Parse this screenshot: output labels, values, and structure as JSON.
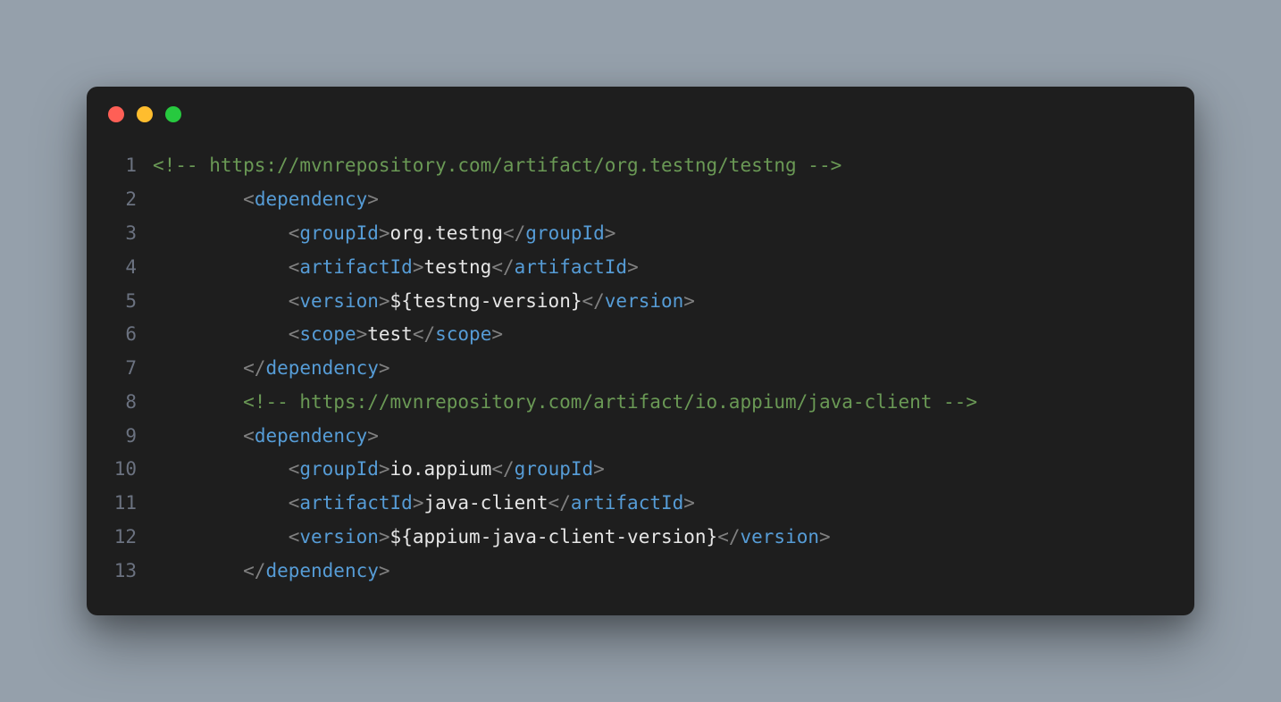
{
  "titlebar": {
    "dots": [
      "red",
      "yellow",
      "green"
    ]
  },
  "code": {
    "lines": [
      {
        "num": "1",
        "indent": "",
        "tokens": [
          {
            "cls": "tok-comment",
            "text": "<!-- https://mvnrepository.com/artifact/org.testng/testng -->"
          }
        ]
      },
      {
        "num": "2",
        "indent": "        ",
        "tokens": [
          {
            "cls": "tok-punct",
            "text": "<"
          },
          {
            "cls": "tok-tag",
            "text": "dependency"
          },
          {
            "cls": "tok-punct",
            "text": ">"
          }
        ]
      },
      {
        "num": "3",
        "indent": "            ",
        "tokens": [
          {
            "cls": "tok-punct",
            "text": "<"
          },
          {
            "cls": "tok-tag",
            "text": "groupId"
          },
          {
            "cls": "tok-punct",
            "text": ">"
          },
          {
            "cls": "tok-text",
            "text": "org.testng"
          },
          {
            "cls": "tok-punct",
            "text": "</"
          },
          {
            "cls": "tok-tag",
            "text": "groupId"
          },
          {
            "cls": "tok-punct",
            "text": ">"
          }
        ]
      },
      {
        "num": "4",
        "indent": "            ",
        "tokens": [
          {
            "cls": "tok-punct",
            "text": "<"
          },
          {
            "cls": "tok-tag",
            "text": "artifactId"
          },
          {
            "cls": "tok-punct",
            "text": ">"
          },
          {
            "cls": "tok-text",
            "text": "testng"
          },
          {
            "cls": "tok-punct",
            "text": "</"
          },
          {
            "cls": "tok-tag",
            "text": "artifactId"
          },
          {
            "cls": "tok-punct",
            "text": ">"
          }
        ]
      },
      {
        "num": "5",
        "indent": "            ",
        "tokens": [
          {
            "cls": "tok-punct",
            "text": "<"
          },
          {
            "cls": "tok-tag",
            "text": "version"
          },
          {
            "cls": "tok-punct",
            "text": ">"
          },
          {
            "cls": "tok-var",
            "text": "${testng-version}"
          },
          {
            "cls": "tok-punct",
            "text": "</"
          },
          {
            "cls": "tok-tag",
            "text": "version"
          },
          {
            "cls": "tok-punct",
            "text": ">"
          }
        ]
      },
      {
        "num": "6",
        "indent": "            ",
        "tokens": [
          {
            "cls": "tok-punct",
            "text": "<"
          },
          {
            "cls": "tok-tag",
            "text": "scope"
          },
          {
            "cls": "tok-punct",
            "text": ">"
          },
          {
            "cls": "tok-text",
            "text": "test"
          },
          {
            "cls": "tok-punct",
            "text": "</"
          },
          {
            "cls": "tok-tag",
            "text": "scope"
          },
          {
            "cls": "tok-punct",
            "text": ">"
          }
        ]
      },
      {
        "num": "7",
        "indent": "        ",
        "tokens": [
          {
            "cls": "tok-punct",
            "text": "</"
          },
          {
            "cls": "tok-tag",
            "text": "dependency"
          },
          {
            "cls": "tok-punct",
            "text": ">"
          }
        ]
      },
      {
        "num": "8",
        "indent": "        ",
        "tokens": [
          {
            "cls": "tok-comment",
            "text": "<!-- https://mvnrepository.com/artifact/io.appium/java-client -->"
          }
        ]
      },
      {
        "num": "9",
        "indent": "        ",
        "tokens": [
          {
            "cls": "tok-punct",
            "text": "<"
          },
          {
            "cls": "tok-tag",
            "text": "dependency"
          },
          {
            "cls": "tok-punct",
            "text": ">"
          }
        ]
      },
      {
        "num": "10",
        "indent": "            ",
        "tokens": [
          {
            "cls": "tok-punct",
            "text": "<"
          },
          {
            "cls": "tok-tag",
            "text": "groupId"
          },
          {
            "cls": "tok-punct",
            "text": ">"
          },
          {
            "cls": "tok-text",
            "text": "io.appium"
          },
          {
            "cls": "tok-punct",
            "text": "</"
          },
          {
            "cls": "tok-tag",
            "text": "groupId"
          },
          {
            "cls": "tok-punct",
            "text": ">"
          }
        ]
      },
      {
        "num": "11",
        "indent": "            ",
        "tokens": [
          {
            "cls": "tok-punct",
            "text": "<"
          },
          {
            "cls": "tok-tag",
            "text": "artifactId"
          },
          {
            "cls": "tok-punct",
            "text": ">"
          },
          {
            "cls": "tok-text",
            "text": "java-client"
          },
          {
            "cls": "tok-punct",
            "text": "</"
          },
          {
            "cls": "tok-tag",
            "text": "artifactId"
          },
          {
            "cls": "tok-punct",
            "text": ">"
          }
        ]
      },
      {
        "num": "12",
        "indent": "            ",
        "tokens": [
          {
            "cls": "tok-punct",
            "text": "<"
          },
          {
            "cls": "tok-tag",
            "text": "version"
          },
          {
            "cls": "tok-punct",
            "text": ">"
          },
          {
            "cls": "tok-var",
            "text": "${appium-java-client-version}"
          },
          {
            "cls": "tok-punct",
            "text": "</"
          },
          {
            "cls": "tok-tag",
            "text": "version"
          },
          {
            "cls": "tok-punct",
            "text": ">"
          }
        ]
      },
      {
        "num": "13",
        "indent": "        ",
        "tokens": [
          {
            "cls": "tok-punct",
            "text": "</"
          },
          {
            "cls": "tok-tag",
            "text": "dependency"
          },
          {
            "cls": "tok-punct",
            "text": ">"
          }
        ]
      }
    ]
  }
}
